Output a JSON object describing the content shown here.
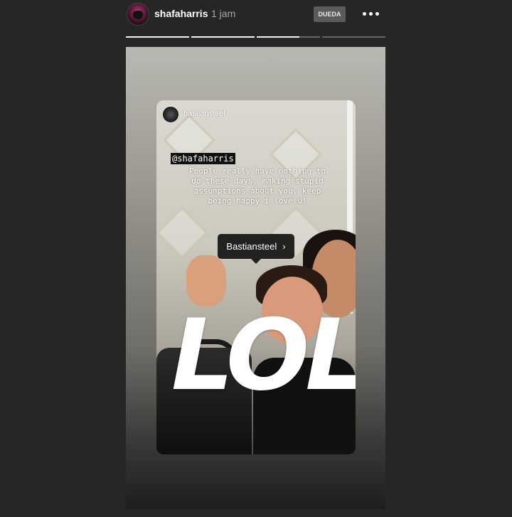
{
  "header": {
    "username": "shafaharris",
    "time": "1 jam",
    "follow_label": "DUEDA",
    "more_icon": "more-horizontal-icon"
  },
  "progress": [
    {
      "fill": 1.0
    },
    {
      "fill": 1.0
    },
    {
      "fill": 0.67
    },
    {
      "fill": 0.0
    }
  ],
  "story": {
    "inner_username": "bastiansteel",
    "mention": "@shafaharris",
    "caption": "People really have nothing to do these days, making stupid assumptions about you, keep being happy i love u!",
    "tag_label": "Bastiansteel",
    "tag_icon": "chevron-right-icon",
    "sticker_text": "LOL"
  },
  "colors": {
    "background": "#262626",
    "progress_fill": "#f2f2f2",
    "progress_track": "#666666"
  }
}
